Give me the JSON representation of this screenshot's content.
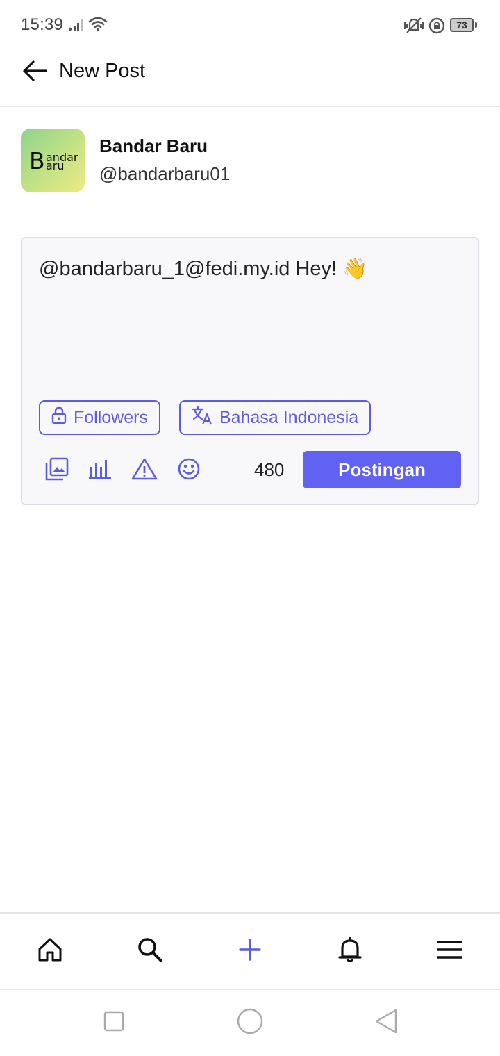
{
  "status_bar": {
    "time": "15:39",
    "battery": "73",
    "icons": [
      "signal-icon",
      "wifi-icon",
      "vibrate-off-icon",
      "rotation-lock-icon",
      "battery-icon"
    ]
  },
  "header": {
    "title": "New Post",
    "back_icon": "arrow-left-icon"
  },
  "account": {
    "display_name": "Bandar Baru",
    "handle": "@bandarbaru01",
    "avatar_text": {
      "big": "B",
      "top": "andar",
      "bottom": "aru"
    }
  },
  "composer": {
    "text": "@bandarbaru_1@fedi.my.id Hey! 👋",
    "visibility_label": "Followers",
    "language_label": "Bahasa Indonesia",
    "char_count": "480",
    "submit_label": "Postingan",
    "tools": [
      "media-icon",
      "poll-icon",
      "content-warning-icon",
      "emoji-icon"
    ]
  },
  "bottom_nav": {
    "items": [
      "home-icon",
      "search-icon",
      "compose-icon",
      "notifications-icon",
      "menu-icon"
    ],
    "active": "compose-icon"
  },
  "system_nav": [
    "recents-icon",
    "home-circle-icon",
    "back-triangle-icon"
  ],
  "colors": {
    "accent": "#6161f2",
    "outline": "#5c5ce0",
    "compose_bg": "#f8f8fb",
    "divider": "#e3e3e8"
  }
}
